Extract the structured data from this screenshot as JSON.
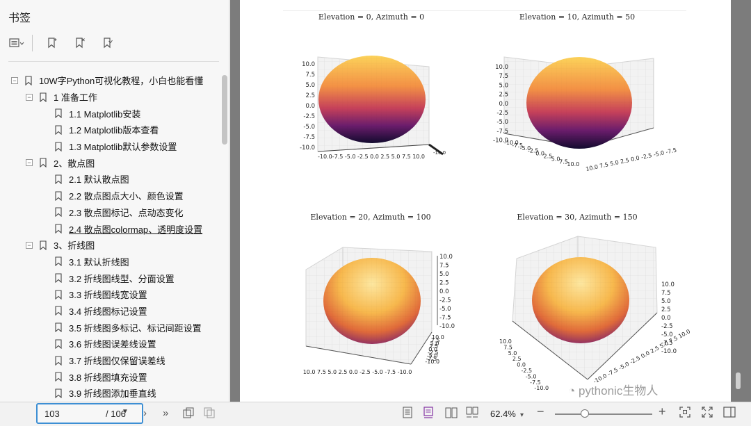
{
  "sidebar": {
    "title": "书签",
    "toolbar": [
      "list-menu-icon",
      "bookmark-add-icon",
      "bookmark-remove-icon",
      "bookmark-icon"
    ],
    "tree": [
      {
        "label": "10W字Python可视化教程，小白也能看懂",
        "level": 0,
        "expanded": true
      },
      {
        "label": "1 准备工作",
        "level": 1,
        "expanded": true
      },
      {
        "label": "1.1 Matplotlib安装",
        "level": 2
      },
      {
        "label": "1.2  Matplotlib版本查看",
        "level": 2
      },
      {
        "label": "1.3 Matplotlib默认参数设置",
        "level": 2
      },
      {
        "label": "2、散点图",
        "level": 1,
        "expanded": true
      },
      {
        "label": "2.1 默认散点图",
        "level": 2
      },
      {
        "label": "2.2 散点图点大小、颜色设置",
        "level": 2
      },
      {
        "label": "2.3 散点图标记、点动态变化",
        "level": 2
      },
      {
        "label": "2.4 散点图colormap、透明度设置",
        "level": 2,
        "selected": true
      },
      {
        "label": "3、折线图",
        "level": 1,
        "expanded": true
      },
      {
        "label": "3.1 默认折线图",
        "level": 2
      },
      {
        "label": "3.2 折线图线型、分面设置",
        "level": 2
      },
      {
        "label": "3.3 折线图线宽设置",
        "level": 2
      },
      {
        "label": "3.4 折线图标记设置",
        "level": 2
      },
      {
        "label": "3.5 折线图多标记、标记间距设置",
        "level": 2
      },
      {
        "label": "3.6 折线图误差线设置",
        "level": 2
      },
      {
        "label": "3.7 折线图仅保留误差线",
        "level": 2
      },
      {
        "label": "3.8 折线图填充设置",
        "level": 2
      },
      {
        "label": "3.9 折线图添加垂直线",
        "level": 2
      }
    ]
  },
  "document": {
    "plots": [
      {
        "title": "Elevation = 0, Azimuth = 0",
        "left_ticks": [
          "10.0",
          "7.5",
          "5.0",
          "2.5",
          "0.0",
          "-2.5",
          "-5.0",
          "-7.5",
          "-10.0"
        ],
        "bottom_ticks": "-10.0-7.5 -5.0 -2.5  0.0  2.5  5.0  7.5 10.0",
        "corner_ticks": "-10.0"
      },
      {
        "title": "Elevation = 10, Azimuth = 50",
        "left_ticks": [
          "10.0",
          "7.5",
          "5.0",
          "2.5",
          "0.0",
          "-2.5",
          "-5.0",
          "-7.5",
          "-10.0"
        ],
        "bottom_left_ticks": [
          "-10.0",
          "-7.5",
          "-5.0",
          "-2.5",
          "0.0",
          "2.5",
          "5.0",
          "7.5",
          "10.0"
        ],
        "bottom_right_ticks": "10.0 7.5 5.0 2.5 0.0 -2.5 -5.0 -7.5"
      },
      {
        "title": "Elevation = 20, Azimuth = 100",
        "right_ticks": [
          "10.0",
          "7.5",
          "5.0",
          "2.5",
          "0.0",
          "-2.5",
          "-5.0",
          "-7.5",
          "-10.0"
        ],
        "bottom_ticks": "10.0  7.5  5.0  2.5  0.0 -2.5 -5.0 -7.5 -10.0",
        "side_ticks": [
          "10.0",
          "7.5",
          "5.0",
          "2.5",
          "0.0",
          "-2.5",
          "-5.0",
          "-7.5",
          "-10.0"
        ]
      },
      {
        "title": "Elevation = 30, Azimuth = 150",
        "right_ticks": [
          "10.0",
          "7.5",
          "5.0",
          "2.5",
          "0.0",
          "-2.5",
          "-5.0",
          "-7.5",
          "-10.0"
        ],
        "bottom_left_ticks": [
          "10.0",
          "7.5",
          "5.0",
          "2.5",
          "0.0",
          "-2.5",
          "-5.0",
          "-7.5",
          "-10.0"
        ],
        "bottom_right_ticks": "-10.0 -7.5 -5.0 -2.5 0.0 2.5 5.0 7.5 10.0"
      }
    ],
    "watermark": "pythonic生物人"
  },
  "bottombar": {
    "page_current": "103",
    "page_total": "/ 106",
    "zoom": "62.4%"
  },
  "colors": {
    "accent": "#3d8fd4",
    "viewer_bg": "#7c7c7c",
    "sphere_top": "#fcd25a",
    "sphere_mid": "#e86b3c",
    "sphere_low": "#7a1f6e",
    "sphere_bottom": "#120a2e"
  }
}
